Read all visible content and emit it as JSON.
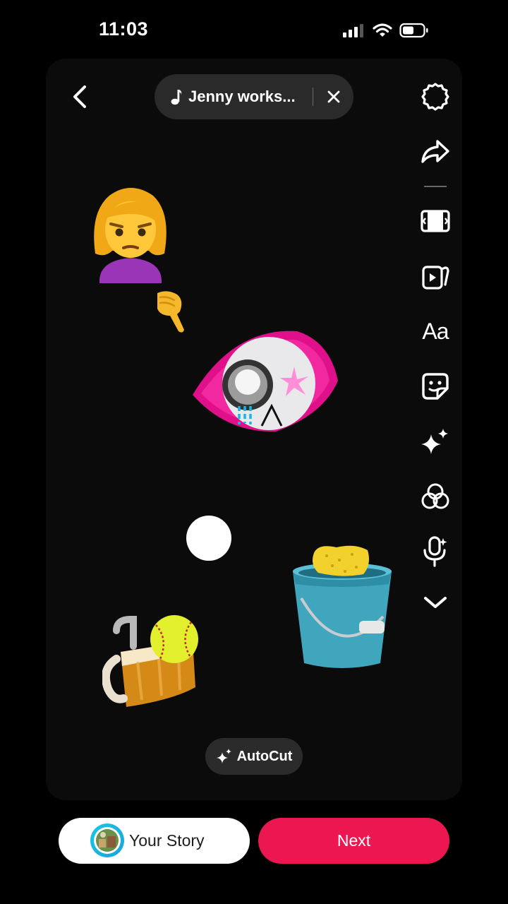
{
  "status_bar": {
    "time": "11:03"
  },
  "header": {
    "music_title": "Jenny works...",
    "icons": [
      "back-chevron-icon",
      "music-note-icon",
      "close-icon"
    ]
  },
  "toolbar": {
    "items": [
      "settings-icon",
      "share-icon",
      "aspect-ratio-icon",
      "templates-icon",
      "text-tool",
      "sticker-icon",
      "effects-sparkle-icon",
      "filters-icon",
      "voice-effect-icon",
      "more-chevron-icon"
    ],
    "text_label": "Aa"
  },
  "stickers": [
    "woman-tipping-hand-emoji",
    "pointing-down-hand-emoji",
    "eye-graphic-sticker",
    "white-dot",
    "bucket-with-sponge-sticker",
    "beer-mug-with-softball-sticker"
  ],
  "autocut": {
    "label": "AutoCut"
  },
  "bottom": {
    "your_story_label": "Your Story",
    "next_label": "Next"
  },
  "colors": {
    "accent": "#ec1650",
    "pill": "#2a2a2a",
    "canvas": "#0b0b0b"
  }
}
